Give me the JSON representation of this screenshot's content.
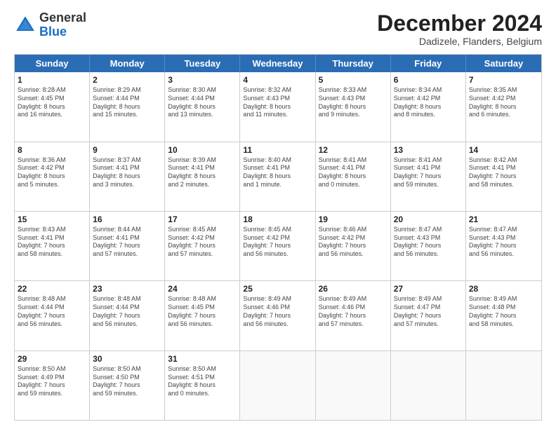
{
  "header": {
    "logo_general": "General",
    "logo_blue": "Blue",
    "month_title": "December 2024",
    "subtitle": "Dadizele, Flanders, Belgium"
  },
  "calendar": {
    "days": [
      "Sunday",
      "Monday",
      "Tuesday",
      "Wednesday",
      "Thursday",
      "Friday",
      "Saturday"
    ],
    "rows": [
      [
        {
          "day": "1",
          "lines": [
            "Sunrise: 8:28 AM",
            "Sunset: 4:45 PM",
            "Daylight: 8 hours",
            "and 16 minutes."
          ]
        },
        {
          "day": "2",
          "lines": [
            "Sunrise: 8:29 AM",
            "Sunset: 4:44 PM",
            "Daylight: 8 hours",
            "and 15 minutes."
          ]
        },
        {
          "day": "3",
          "lines": [
            "Sunrise: 8:30 AM",
            "Sunset: 4:44 PM",
            "Daylight: 8 hours",
            "and 13 minutes."
          ]
        },
        {
          "day": "4",
          "lines": [
            "Sunrise: 8:32 AM",
            "Sunset: 4:43 PM",
            "Daylight: 8 hours",
            "and 11 minutes."
          ]
        },
        {
          "day": "5",
          "lines": [
            "Sunrise: 8:33 AM",
            "Sunset: 4:43 PM",
            "Daylight: 8 hours",
            "and 9 minutes."
          ]
        },
        {
          "day": "6",
          "lines": [
            "Sunrise: 8:34 AM",
            "Sunset: 4:42 PM",
            "Daylight: 8 hours",
            "and 8 minutes."
          ]
        },
        {
          "day": "7",
          "lines": [
            "Sunrise: 8:35 AM",
            "Sunset: 4:42 PM",
            "Daylight: 8 hours",
            "and 6 minutes."
          ]
        }
      ],
      [
        {
          "day": "8",
          "lines": [
            "Sunrise: 8:36 AM",
            "Sunset: 4:42 PM",
            "Daylight: 8 hours",
            "and 5 minutes."
          ]
        },
        {
          "day": "9",
          "lines": [
            "Sunrise: 8:37 AM",
            "Sunset: 4:41 PM",
            "Daylight: 8 hours",
            "and 3 minutes."
          ]
        },
        {
          "day": "10",
          "lines": [
            "Sunrise: 8:39 AM",
            "Sunset: 4:41 PM",
            "Daylight: 8 hours",
            "and 2 minutes."
          ]
        },
        {
          "day": "11",
          "lines": [
            "Sunrise: 8:40 AM",
            "Sunset: 4:41 PM",
            "Daylight: 8 hours",
            "and 1 minute."
          ]
        },
        {
          "day": "12",
          "lines": [
            "Sunrise: 8:41 AM",
            "Sunset: 4:41 PM",
            "Daylight: 8 hours",
            "and 0 minutes."
          ]
        },
        {
          "day": "13",
          "lines": [
            "Sunrise: 8:41 AM",
            "Sunset: 4:41 PM",
            "Daylight: 7 hours",
            "and 59 minutes."
          ]
        },
        {
          "day": "14",
          "lines": [
            "Sunrise: 8:42 AM",
            "Sunset: 4:41 PM",
            "Daylight: 7 hours",
            "and 58 minutes."
          ]
        }
      ],
      [
        {
          "day": "15",
          "lines": [
            "Sunrise: 8:43 AM",
            "Sunset: 4:41 PM",
            "Daylight: 7 hours",
            "and 58 minutes."
          ]
        },
        {
          "day": "16",
          "lines": [
            "Sunrise: 8:44 AM",
            "Sunset: 4:41 PM",
            "Daylight: 7 hours",
            "and 57 minutes."
          ]
        },
        {
          "day": "17",
          "lines": [
            "Sunrise: 8:45 AM",
            "Sunset: 4:42 PM",
            "Daylight: 7 hours",
            "and 57 minutes."
          ]
        },
        {
          "day": "18",
          "lines": [
            "Sunrise: 8:45 AM",
            "Sunset: 4:42 PM",
            "Daylight: 7 hours",
            "and 56 minutes."
          ]
        },
        {
          "day": "19",
          "lines": [
            "Sunrise: 8:46 AM",
            "Sunset: 4:42 PM",
            "Daylight: 7 hours",
            "and 56 minutes."
          ]
        },
        {
          "day": "20",
          "lines": [
            "Sunrise: 8:47 AM",
            "Sunset: 4:43 PM",
            "Daylight: 7 hours",
            "and 56 minutes."
          ]
        },
        {
          "day": "21",
          "lines": [
            "Sunrise: 8:47 AM",
            "Sunset: 4:43 PM",
            "Daylight: 7 hours",
            "and 56 minutes."
          ]
        }
      ],
      [
        {
          "day": "22",
          "lines": [
            "Sunrise: 8:48 AM",
            "Sunset: 4:44 PM",
            "Daylight: 7 hours",
            "and 56 minutes."
          ]
        },
        {
          "day": "23",
          "lines": [
            "Sunrise: 8:48 AM",
            "Sunset: 4:44 PM",
            "Daylight: 7 hours",
            "and 56 minutes."
          ]
        },
        {
          "day": "24",
          "lines": [
            "Sunrise: 8:48 AM",
            "Sunset: 4:45 PM",
            "Daylight: 7 hours",
            "and 56 minutes."
          ]
        },
        {
          "day": "25",
          "lines": [
            "Sunrise: 8:49 AM",
            "Sunset: 4:46 PM",
            "Daylight: 7 hours",
            "and 56 minutes."
          ]
        },
        {
          "day": "26",
          "lines": [
            "Sunrise: 8:49 AM",
            "Sunset: 4:46 PM",
            "Daylight: 7 hours",
            "and 57 minutes."
          ]
        },
        {
          "day": "27",
          "lines": [
            "Sunrise: 8:49 AM",
            "Sunset: 4:47 PM",
            "Daylight: 7 hours",
            "and 57 minutes."
          ]
        },
        {
          "day": "28",
          "lines": [
            "Sunrise: 8:49 AM",
            "Sunset: 4:48 PM",
            "Daylight: 7 hours",
            "and 58 minutes."
          ]
        }
      ],
      [
        {
          "day": "29",
          "lines": [
            "Sunrise: 8:50 AM",
            "Sunset: 4:49 PM",
            "Daylight: 7 hours",
            "and 59 minutes."
          ]
        },
        {
          "day": "30",
          "lines": [
            "Sunrise: 8:50 AM",
            "Sunset: 4:50 PM",
            "Daylight: 7 hours",
            "and 59 minutes."
          ]
        },
        {
          "day": "31",
          "lines": [
            "Sunrise: 8:50 AM",
            "Sunset: 4:51 PM",
            "Daylight: 8 hours",
            "and 0 minutes."
          ]
        },
        {
          "day": "",
          "lines": []
        },
        {
          "day": "",
          "lines": []
        },
        {
          "day": "",
          "lines": []
        },
        {
          "day": "",
          "lines": []
        }
      ]
    ]
  }
}
